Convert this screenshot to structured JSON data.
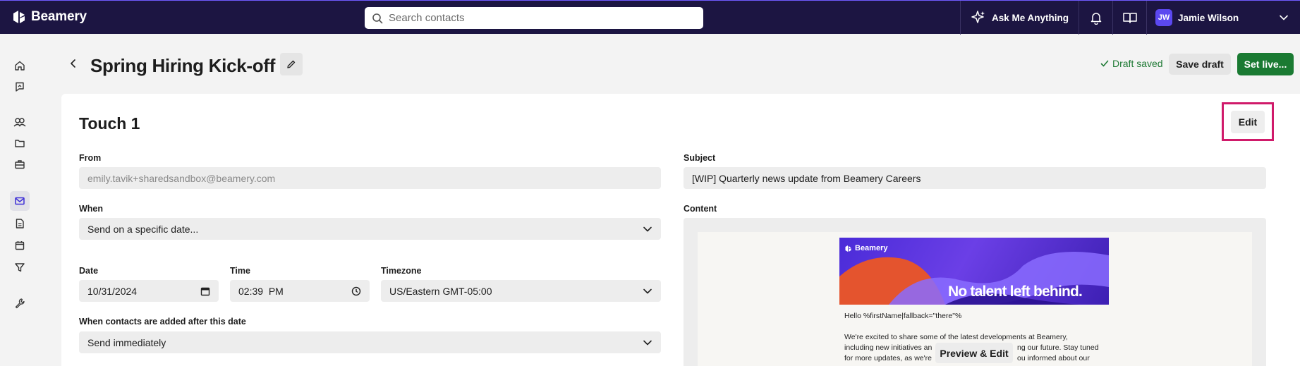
{
  "app": {
    "brand": "Beamery"
  },
  "topbar": {
    "search_placeholder": "Search contacts",
    "ask_label": "Ask Me Anything",
    "user_initials": "JW",
    "user_name": "Jamie Wilson"
  },
  "sidebar": {
    "items": [
      {
        "icon": "home-icon"
      },
      {
        "icon": "flag-chat-icon"
      },
      {
        "icon": "people-icon"
      },
      {
        "icon": "folder-icon"
      },
      {
        "icon": "briefcase-icon"
      },
      {
        "icon": "mail-icon",
        "active": true
      },
      {
        "icon": "document-icon"
      },
      {
        "icon": "calendar-icon"
      },
      {
        "icon": "filter-icon"
      },
      {
        "icon": "wrench-icon"
      }
    ]
  },
  "header": {
    "title": "Spring Hiring Kick-off",
    "draft_status": "Draft saved",
    "save_draft_label": "Save draft",
    "set_live_label": "Set live..."
  },
  "touch": {
    "title": "Touch 1",
    "edit_label": "Edit",
    "from_label": "From",
    "from_value": "emily.tavik+sharedsandbox@beamery.com",
    "when_label": "When",
    "when_value": "Send on a specific date...",
    "date_label": "Date",
    "date_value": "10/31/2024",
    "time_label": "Time",
    "time_value": "02:39  PM",
    "timezone_label": "Timezone",
    "timezone_value": "US/Eastern GMT-05:00",
    "after_label": "When contacts are added after this date",
    "after_value": "Send immediately",
    "subject_label": "Subject",
    "subject_value": "[WIP] Quarterly news update from Beamery Careers",
    "content_label": "Content"
  },
  "email_preview": {
    "logo_text": "Beamery",
    "tagline": "No talent left behind.",
    "greeting": "Hello %firstName|fallback=\"there\"%",
    "line1": "We're excited to share some of the latest developments at Beamery,",
    "line2": "including new initiatives an",
    "line2_tail": "ng our future. Stay tuned",
    "line3": "for more updates, as we're",
    "line3_tail": "ou informed about our",
    "preview_edit_label": "Preview & Edit"
  },
  "colors": {
    "topbar_bg": "#1c1542",
    "primary_green": "#1a7a32",
    "highlight": "#d01a6a",
    "accent_purple": "#5b48f0"
  }
}
